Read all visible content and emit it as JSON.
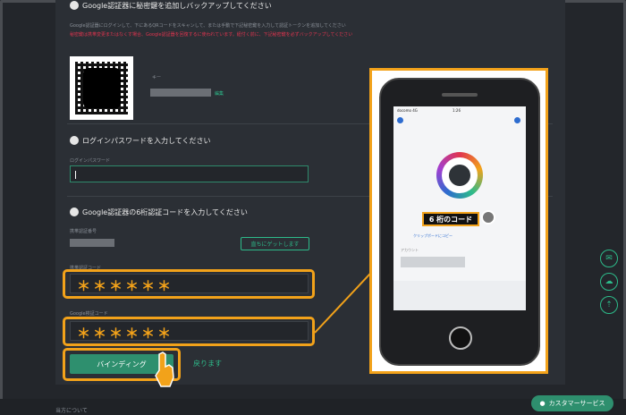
{
  "steps": {
    "step1_label": "Google認証器に秘密鍵を追加しバックアップしてください",
    "step1_desc": "Google認証器にログインして、下にあるQRコードをスキャンして、または手動で下記秘密鍵を入力して認証トークンを追加してください",
    "step1_warn": "秘密鍵は携帯変更またはなくす場合、Google認証器を回復するに使われています。紐付く前に、下記秘密鍵を必ずバックアップしてください",
    "key_label": "キー",
    "edit_label": "編集",
    "step2_label": "ログインパスワードを入力してください",
    "password_placeholder": "ログインパスワード",
    "step3_label": "Google認証器の6桁認証コードを入力してください",
    "phone_code_label": "携帯認証番号",
    "get_code_button": "直ちにゲットします",
    "sms_code_placeholder": "携帯認証コード",
    "google_code_label": "Google検証コード",
    "sms_code_stars": "＊＊＊＊＊＊",
    "google_code_stars": "＊＊＊＊＊＊"
  },
  "actions": {
    "bind_button": "バインディング",
    "back_link": "戻ります"
  },
  "phone": {
    "carrier": "docomo 4G",
    "time": "1:26",
    "code_callout": "6 桁のコード",
    "copy_label": "クリップボードにコピー",
    "account_label": "アカウント"
  },
  "footer": {
    "about": "当方について"
  },
  "support": {
    "customer_service": "カスタマーサービス"
  },
  "colors": {
    "accent": "#2dbb8a",
    "highlight": "#f2a21a",
    "warning": "#e0344f"
  }
}
